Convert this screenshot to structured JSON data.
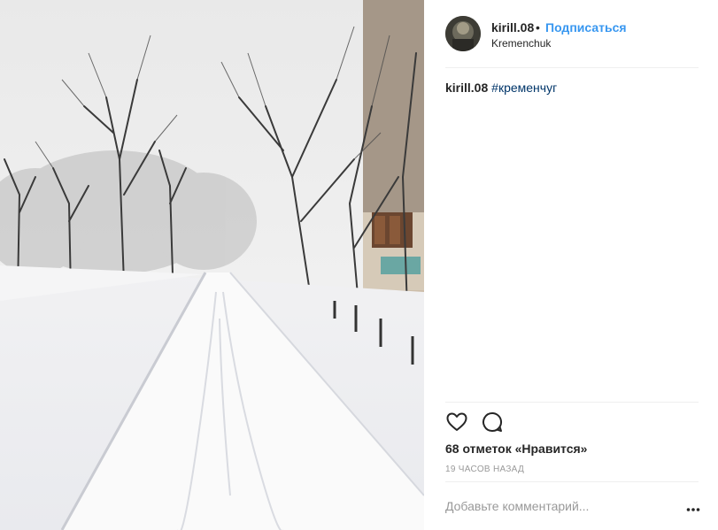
{
  "post": {
    "username": "kirill.08",
    "separator": "•",
    "follow_label": "Подписаться",
    "location": "Kremenchuk",
    "caption": {
      "username": "kirill.08",
      "hashtag": "#кременчуг"
    },
    "likes_text": "68 отметок «Нравится»",
    "time_text": "19 ЧАСОВ НАЗАД",
    "comment_placeholder": "Добавьте комментарий..."
  },
  "icons": {
    "like": "heart-outline-icon",
    "comment": "speech-bubble-icon",
    "more": "ellipsis-icon"
  },
  "colors": {
    "link": "#3897f0",
    "hashtag": "#003569",
    "text": "#262626",
    "muted": "#999999"
  }
}
